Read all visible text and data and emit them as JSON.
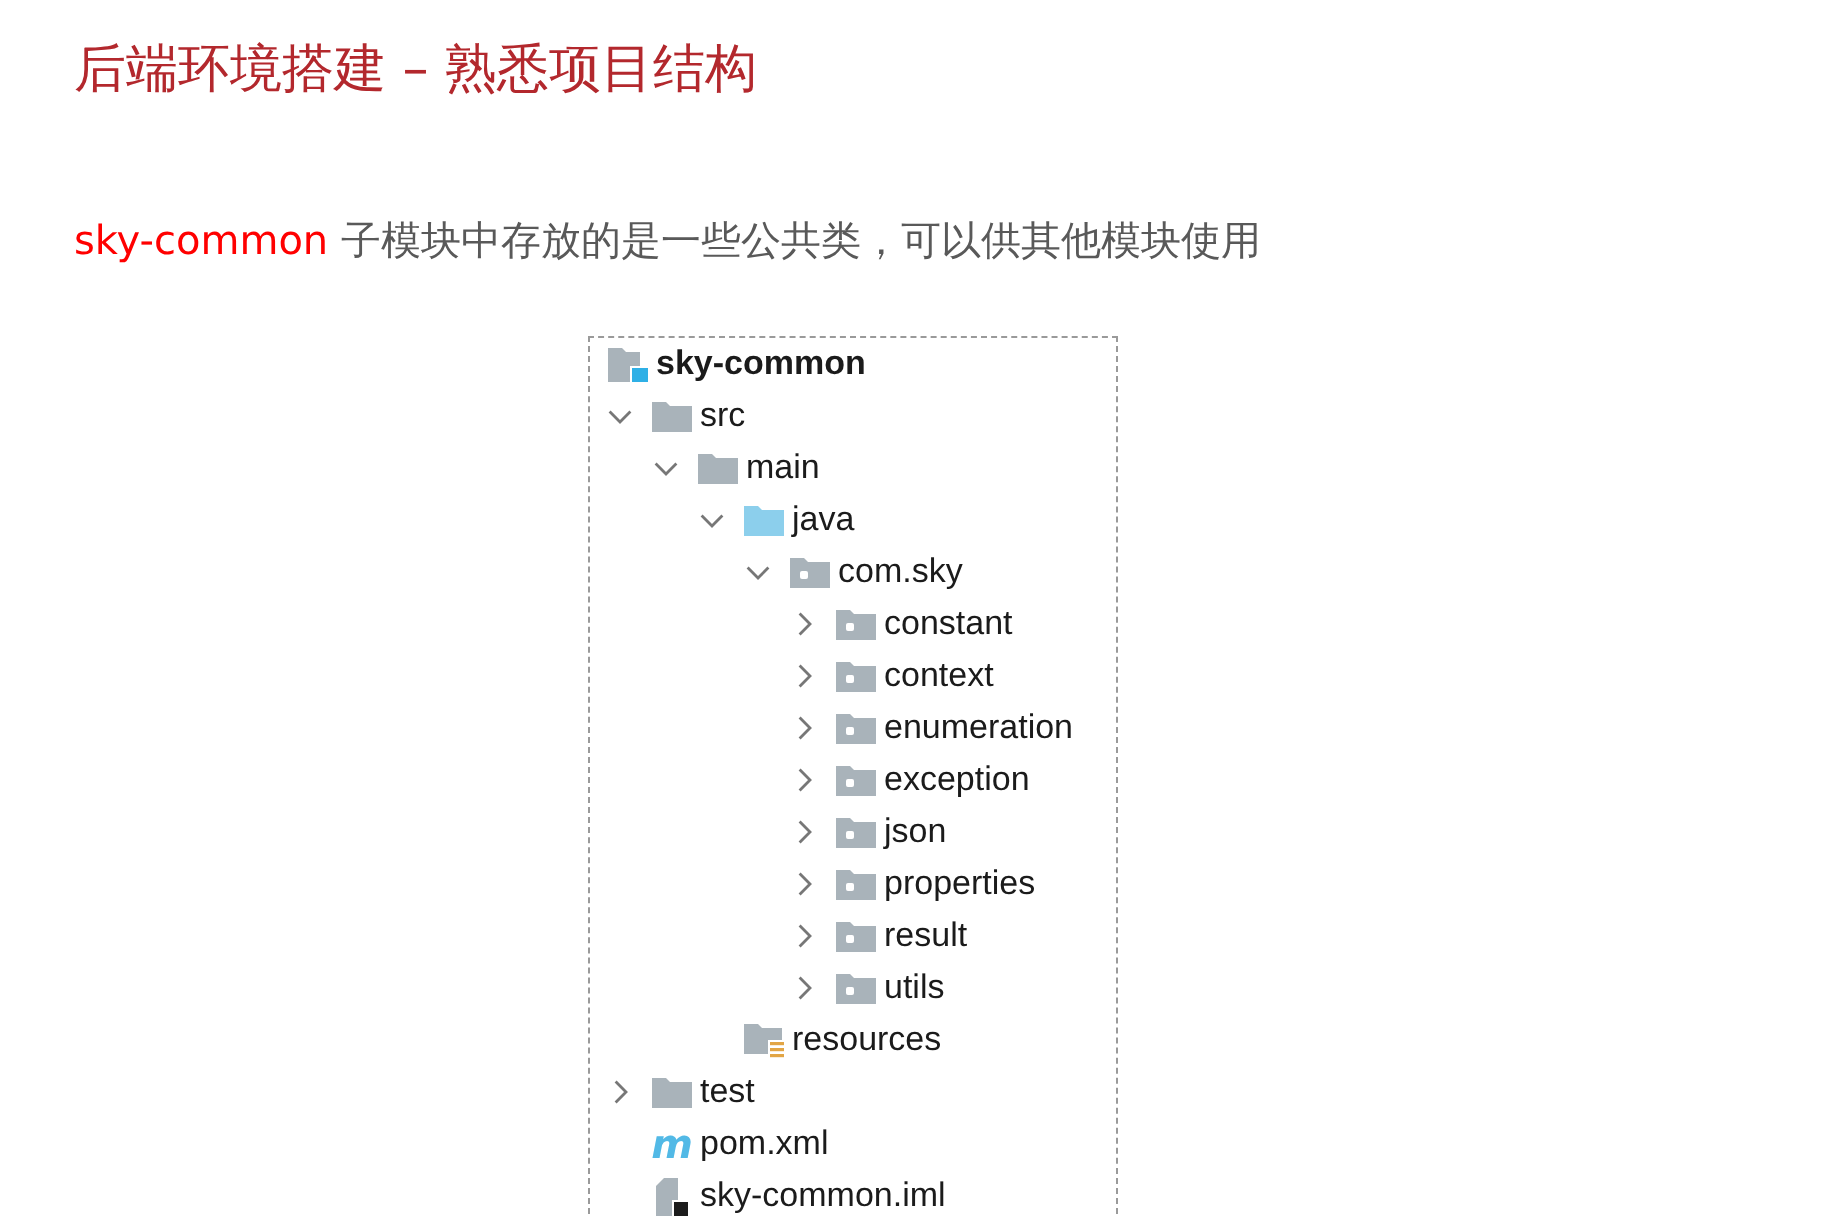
{
  "title": "后端环境搭建 – 熟悉项目结构",
  "intro": {
    "highlight": "sky-common",
    "text": "子模块中存放的是一些公共类，可以供其他模块使用"
  },
  "project_tree": {
    "label": "sky-common",
    "kind": "module",
    "children": [
      {
        "label": "src",
        "kind": "folder",
        "expanded": true,
        "children": [
          {
            "label": "main",
            "kind": "folder",
            "expanded": true,
            "children": [
              {
                "label": "java",
                "kind": "source_root",
                "expanded": true,
                "children": [
                  {
                    "label": "com.sky",
                    "kind": "package",
                    "expanded": true,
                    "children": [
                      {
                        "label": "constant",
                        "kind": "package",
                        "expanded": false
                      },
                      {
                        "label": "context",
                        "kind": "package",
                        "expanded": false
                      },
                      {
                        "label": "enumeration",
                        "kind": "package",
                        "expanded": false
                      },
                      {
                        "label": "exception",
                        "kind": "package",
                        "expanded": false
                      },
                      {
                        "label": "json",
                        "kind": "package",
                        "expanded": false
                      },
                      {
                        "label": "properties",
                        "kind": "package",
                        "expanded": false
                      },
                      {
                        "label": "result",
                        "kind": "package",
                        "expanded": false
                      },
                      {
                        "label": "utils",
                        "kind": "package",
                        "expanded": false
                      }
                    ]
                  }
                ]
              },
              {
                "label": "resources",
                "kind": "resources_root"
              }
            ]
          }
        ]
      },
      {
        "label": "test",
        "kind": "folder",
        "expanded": false
      },
      {
        "label": "pom.xml",
        "kind": "maven",
        "icon": "m"
      },
      {
        "label": "sky-common.iml",
        "kind": "module_file"
      }
    ]
  }
}
